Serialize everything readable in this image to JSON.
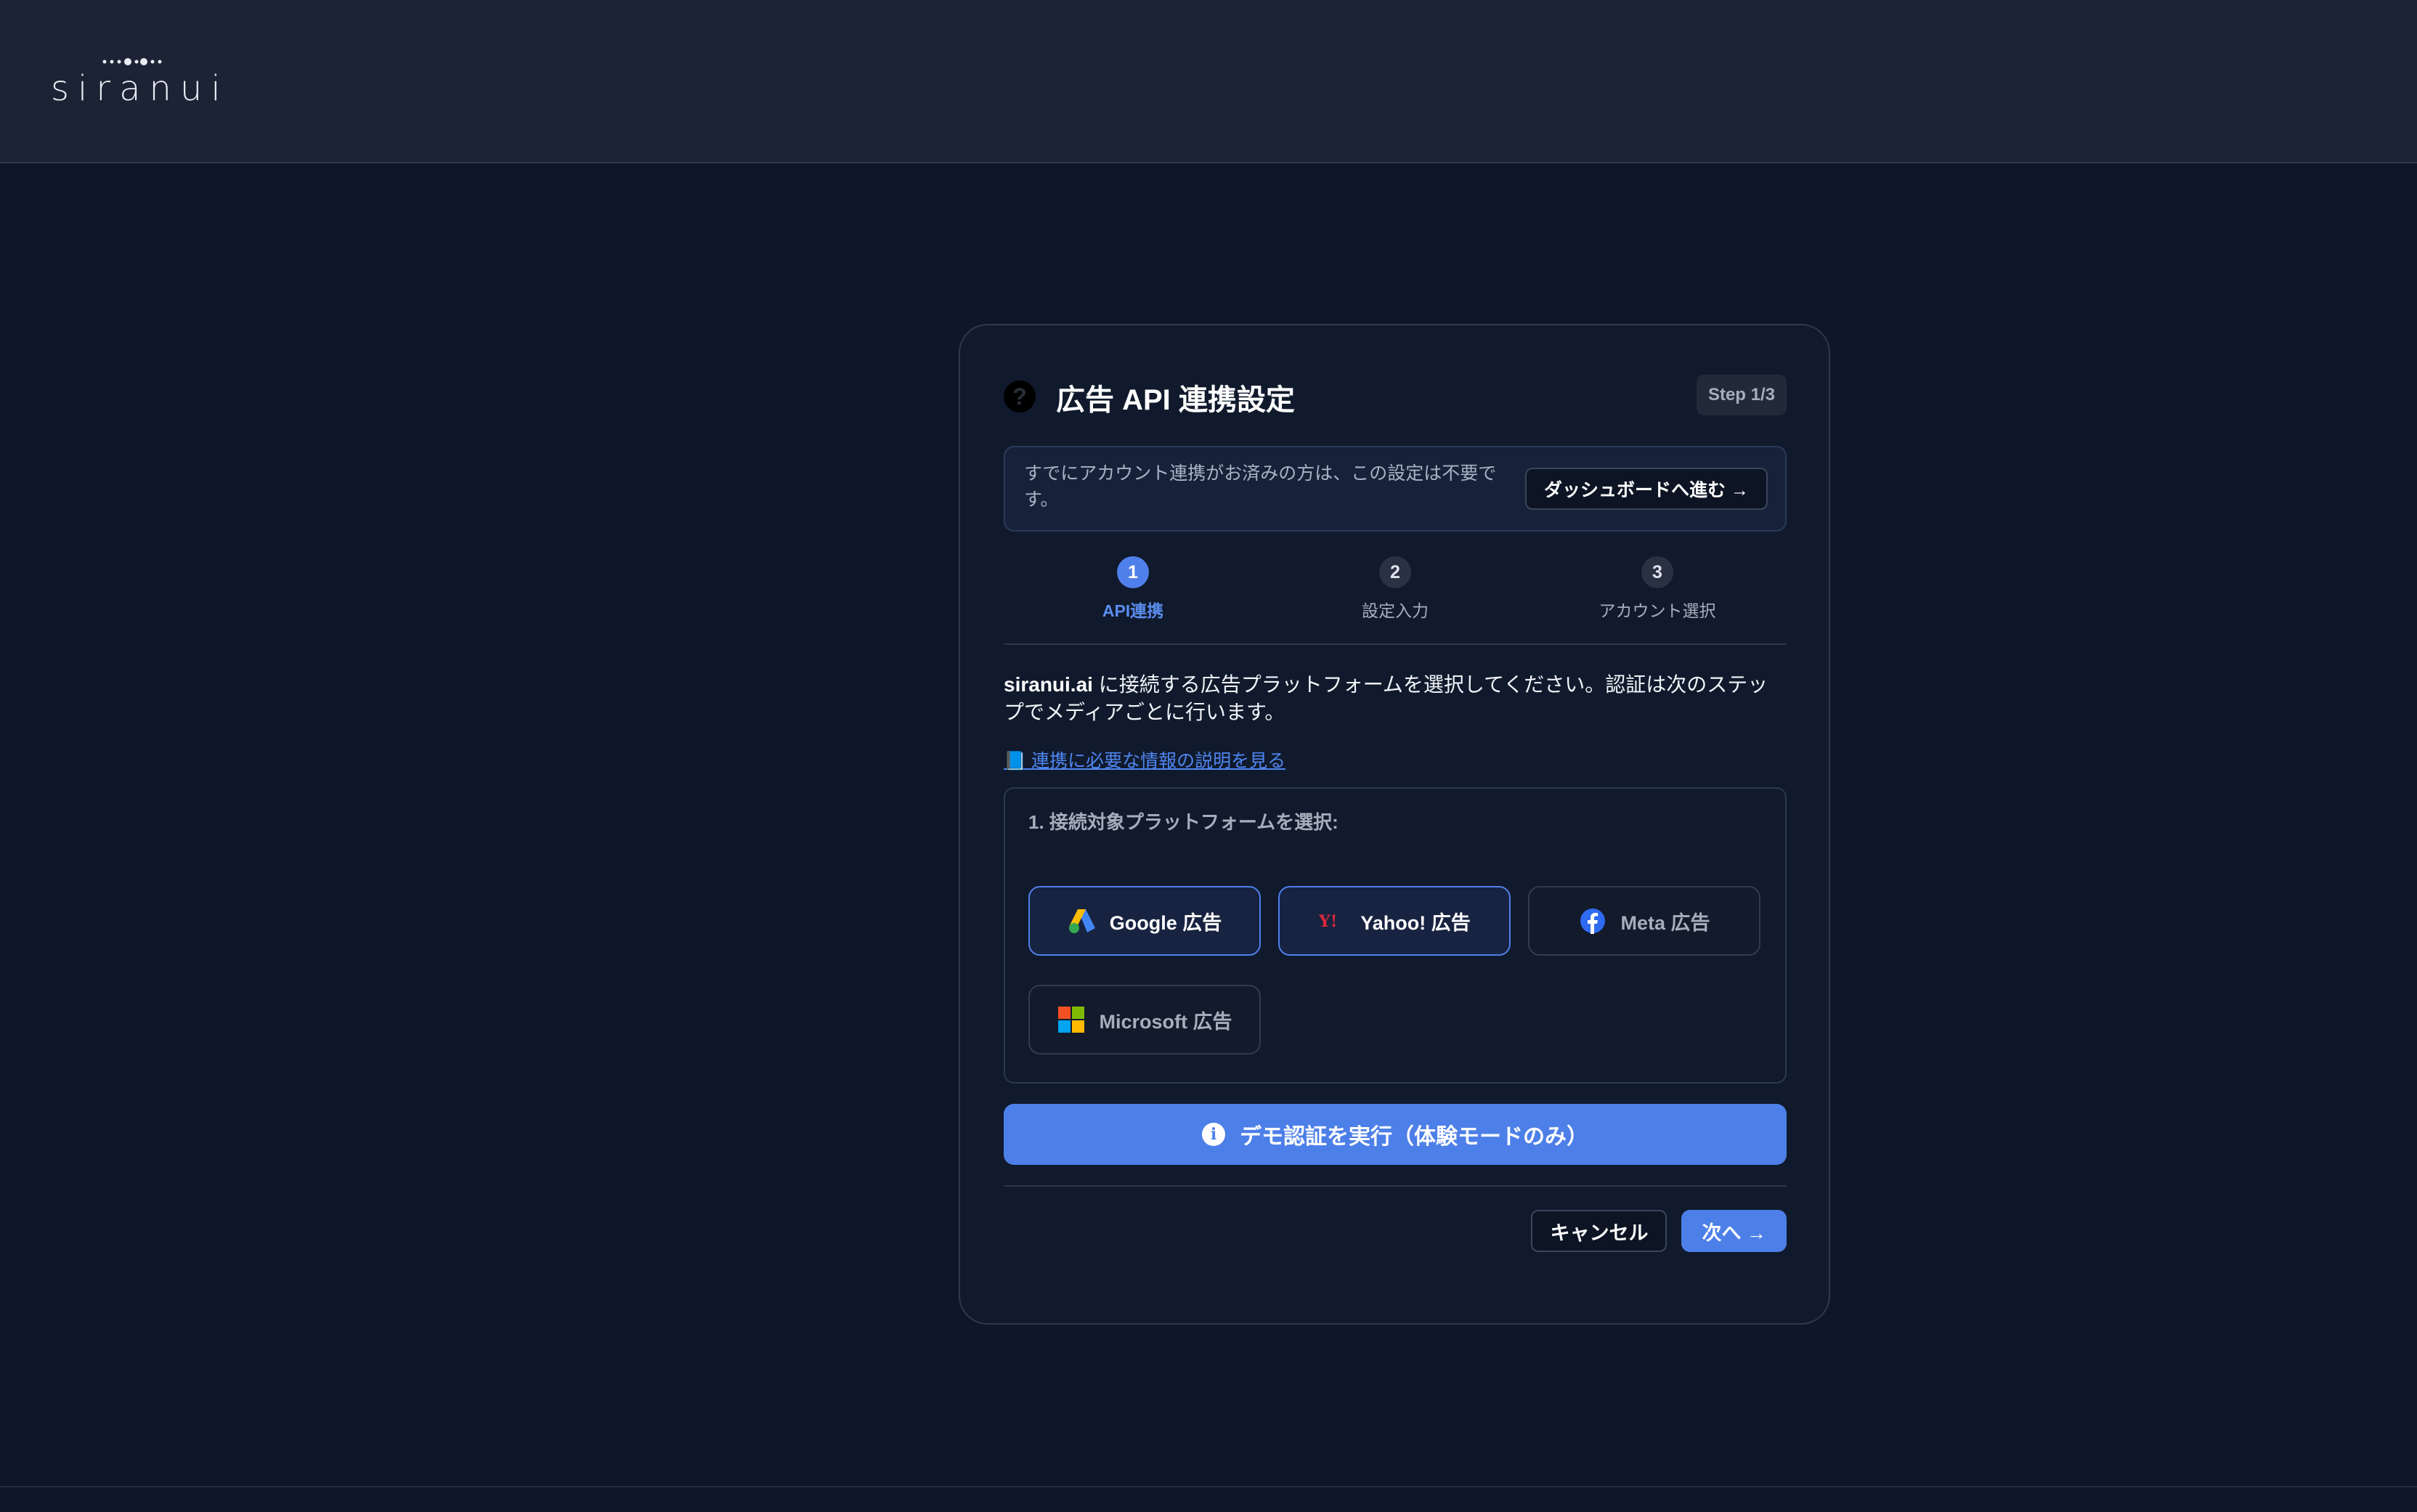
{
  "app": {
    "logo_text": "siranui"
  },
  "dialog": {
    "title": "広告 API 連携設定",
    "step_badge": "Step 1/3",
    "notice": {
      "text": "すでにアカウント連携がお済みの方は、この設定は不要です。",
      "button": "ダッシュボードへ進む →"
    },
    "steps": [
      {
        "num": "1",
        "label": "API連携",
        "active": true
      },
      {
        "num": "2",
        "label": "設定入力",
        "active": false
      },
      {
        "num": "3",
        "label": "アカウント選択",
        "active": false
      }
    ],
    "intro_brand": "siranui.ai",
    "intro_text": " に接続する広告プラットフォームを選択してください。認証は次のステップでメディアごとに行います。",
    "help_link": "📘 連携に必要な情報の説明を見る",
    "platform_heading": "1. 接続対象プラットフォームを選択:",
    "platforms": [
      {
        "label": "Google 広告",
        "icon": "google-ads-icon",
        "selected": true
      },
      {
        "label": "Yahoo! 広告",
        "icon": "yahoo-icon",
        "selected": true
      },
      {
        "label": "Meta 広告",
        "icon": "facebook-icon",
        "selected": false
      },
      {
        "label": "Microsoft 広告",
        "icon": "microsoft-icon",
        "selected": false
      }
    ],
    "demo_button": "デモ認証を実行（体験モードのみ）",
    "cancel_button": "キャンセル",
    "next_button": "次へ →"
  },
  "colors": {
    "accent": "#4d7fe8",
    "background": "#0f1628",
    "card": "#101a2c",
    "header": "#1c2334"
  }
}
